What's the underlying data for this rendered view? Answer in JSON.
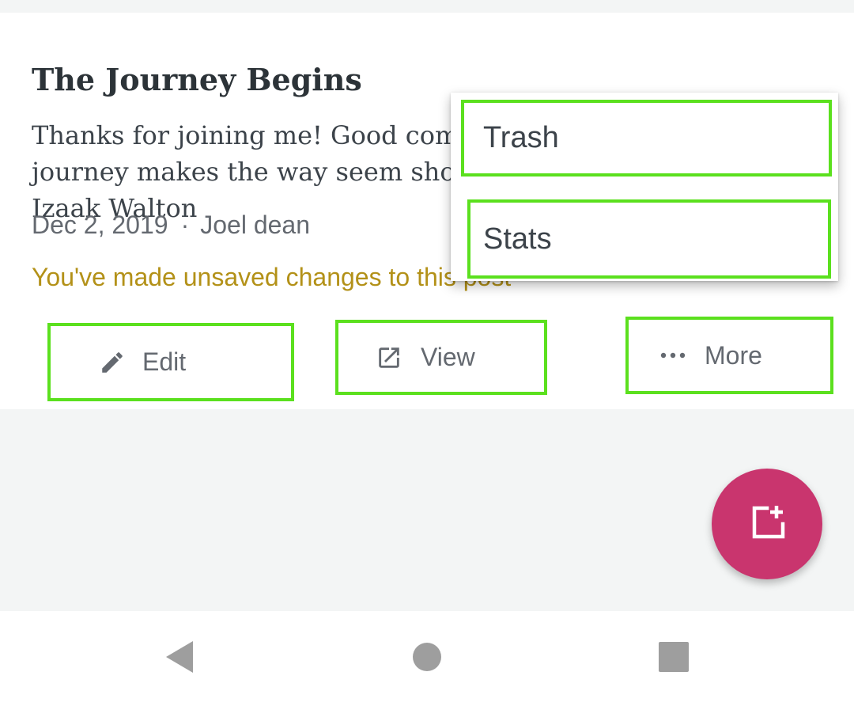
{
  "post": {
    "title": "The Journey Begins",
    "excerpt": "Thanks for joining me! Good company in a journey makes the way seem shorter. — Izaak Walton",
    "date": "Dec 2, 2019",
    "separator": "·",
    "author": "Joel dean",
    "unsaved_notice": "You've made unsaved changes to this post"
  },
  "actions": {
    "edit": {
      "label": "Edit",
      "icon": "pencil-icon"
    },
    "view": {
      "label": "View",
      "icon": "external-link-icon"
    },
    "more": {
      "label": "More",
      "icon": "ellipsis-icon"
    }
  },
  "menu": {
    "items": [
      {
        "label": "Trash"
      },
      {
        "label": "Stats"
      }
    ]
  },
  "fab": {
    "icon": "new-post-icon",
    "color": "#c9356e"
  },
  "navbar": {
    "back_icon": "back-triangle-icon",
    "home_icon": "home-circle-icon",
    "recents_icon": "recents-square-icon"
  },
  "colors": {
    "highlight": "#5be01e",
    "unsaved": "#b39118",
    "text_muted": "#646970"
  }
}
